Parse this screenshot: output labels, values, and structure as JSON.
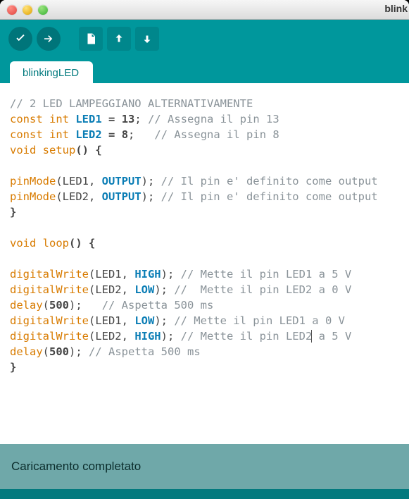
{
  "window": {
    "title": "blink"
  },
  "toolbar": {
    "verify": "verify",
    "upload": "upload",
    "new": "new",
    "open": "open",
    "save": "save"
  },
  "tabs": [
    {
      "label": "blinkingLED"
    }
  ],
  "code": {
    "l1_comment": "// 2 LED LAMPEGGIANO ALTERNATIVAMENTE",
    "l2_a": "const int",
    "l2_b": "LED1",
    "l2_c": "=",
    "l2_d": "13",
    "l2_e": ";",
    "l2_f": "// Assegna il pin 13",
    "l3_a": "const int",
    "l3_b": "LED2",
    "l3_c": "=",
    "l3_d": "8",
    "l3_e": ";  ",
    "l3_f": "// Assegna il pin 8",
    "l4_a": "void",
    "l4_b": "setup",
    "l4_c": "() {",
    "l6_a": "pinMode",
    "l6_b": "(LED1, ",
    "l6_c": "OUTPUT",
    "l6_d": "); ",
    "l6_e": "// Il pin e' definito come output",
    "l7_a": "pinMode",
    "l7_b": "(LED2, ",
    "l7_c": "OUTPUT",
    "l7_d": "); ",
    "l7_e": "// Il pin e' definito come output",
    "l8": "}",
    "l10_a": "void",
    "l10_b": "loop",
    "l10_c": "() {",
    "l12_a": "digitalWrite",
    "l12_b": "(LED1, ",
    "l12_c": "HIGH",
    "l12_d": "); ",
    "l12_e": "// Mette il pin LED1 a 5 V",
    "l13_a": "digitalWrite",
    "l13_b": "(LED2, ",
    "l13_c": "LOW",
    "l13_d": "); ",
    "l13_e": "//  Mette il pin LED2 a 0 V",
    "l14_a": "delay",
    "l14_b": "(",
    "l14_c": "500",
    "l14_d": ");   ",
    "l14_e": "// Aspetta 500 ms",
    "l15_a": "digitalWrite",
    "l15_b": "(LED1, ",
    "l15_c": "LOW",
    "l15_d": "); ",
    "l15_e": "// Mette il pin LED1 a 0 V",
    "l16_a": "digitalWrite",
    "l16_b": "(LED2, ",
    "l16_c": "HIGH",
    "l16_d": "); ",
    "l16_e": "// Mette il pin LED2",
    "l16_f": " a 5 V",
    "l17_a": "delay",
    "l17_b": "(",
    "l17_c": "500",
    "l17_d": "); ",
    "l17_e": "// Aspetta 500 ms",
    "l18": "}"
  },
  "status": {
    "text": "Caricamento completato"
  }
}
